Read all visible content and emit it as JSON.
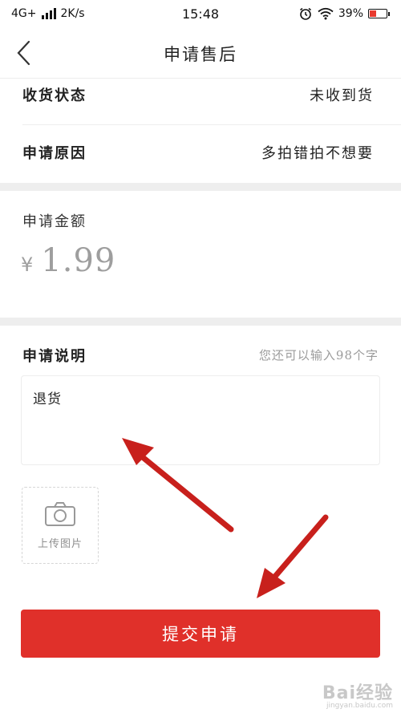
{
  "status_bar": {
    "network": "4G+",
    "speed": "2K/s",
    "time": "15:48",
    "battery_percent": "39%",
    "battery_level": 0.39,
    "icons": [
      "signal-icon",
      "alarm-icon",
      "wifi-icon",
      "battery-icon"
    ]
  },
  "nav": {
    "title": "申请售后",
    "back_icon": "back-arrow-icon"
  },
  "form": {
    "receipt_status": {
      "label": "收货状态",
      "value": "未收到货"
    },
    "reason": {
      "label": "申请原因",
      "value": "多拍错拍不想要"
    },
    "amount": {
      "label": "申请金额",
      "currency": "¥",
      "value": "1.99"
    },
    "description": {
      "label": "申请说明",
      "counter": "您还可以输入98个字",
      "text": "退货"
    },
    "upload": {
      "label": "上传图片",
      "icon": "camera-icon"
    },
    "submit_label": "提交申请"
  },
  "annotations": {
    "arrow_color": "#c8201c"
  },
  "watermark": {
    "logo": "Bai经验",
    "url": "jingyan.baidu.com"
  },
  "colors": {
    "accent": "#e0302a",
    "divider": "#eeeeee",
    "muted": "#9e9e9e"
  }
}
